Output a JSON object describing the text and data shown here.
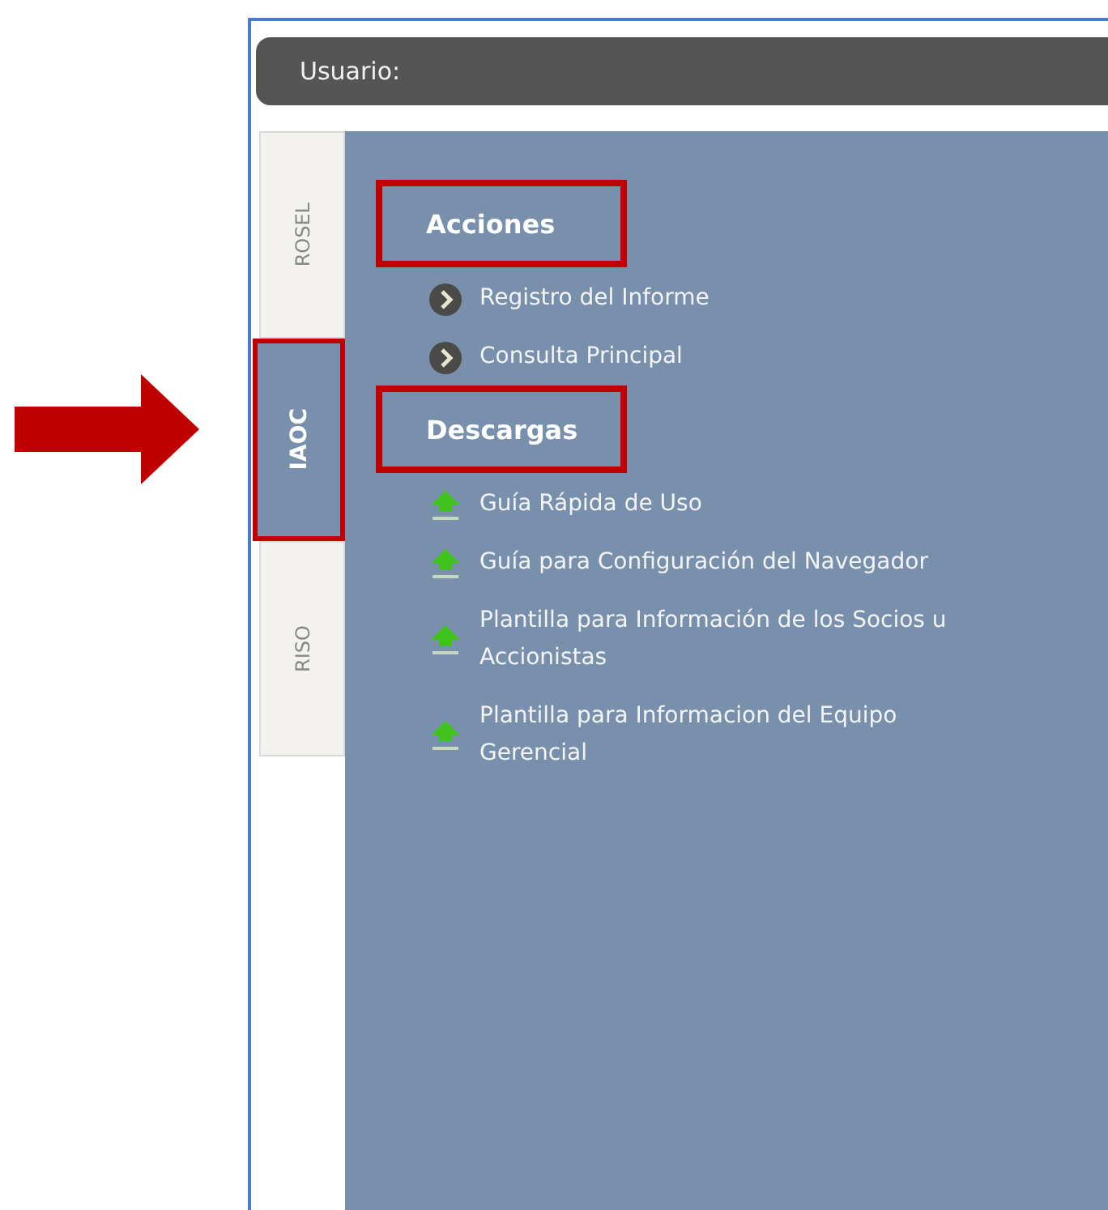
{
  "header": {
    "label": "Usuario:"
  },
  "tabs": [
    {
      "label": "ROSEL",
      "selected": false,
      "highlighted": false
    },
    {
      "label": "IAOC",
      "selected": true,
      "highlighted": true
    },
    {
      "label": "RISO",
      "selected": false,
      "highlighted": false
    }
  ],
  "sections": [
    {
      "title": "Acciones",
      "highlighted": true,
      "items": [
        {
          "kind": "action",
          "label": "Registro del Informe"
        },
        {
          "kind": "action",
          "label": "Consulta Principal"
        }
      ]
    },
    {
      "title": "Descargas",
      "highlighted": true,
      "items": [
        {
          "kind": "download",
          "label": "Guía Rápida de Uso"
        },
        {
          "kind": "download",
          "label": "Guía para Configuración del Navegador"
        },
        {
          "kind": "download",
          "label": "Plantilla para Información de los Socios u Accionistas"
        },
        {
          "kind": "download",
          "label": "Plantilla para Informacion del Equipo Gerencial"
        }
      ]
    }
  ]
}
